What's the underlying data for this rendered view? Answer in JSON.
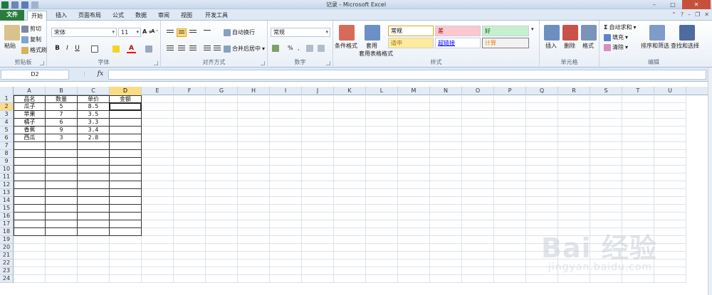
{
  "window": {
    "title": "记录 - Microsoft Excel"
  },
  "tabs": {
    "file": "文件",
    "items": [
      "开始",
      "插入",
      "页面布局",
      "公式",
      "数据",
      "审阅",
      "视图",
      "开发工具"
    ]
  },
  "ribbon": {
    "clipboard": {
      "label": "剪贴板",
      "paste": "粘贴",
      "cut": "剪切",
      "copy": "复制",
      "format_painter": "格式刷"
    },
    "font": {
      "label": "字体",
      "name": "宋体",
      "size": "11",
      "bold": "B",
      "italic": "I",
      "underline": "U"
    },
    "alignment": {
      "label": "对齐方式",
      "wrap": "自动换行",
      "merge": "合并后居中"
    },
    "number": {
      "label": "数字",
      "format": "常规",
      "percent": "%"
    },
    "styles": {
      "label": "样式",
      "cond_format": "条件格式",
      "table_format": "套用表格格式",
      "cells": [
        {
          "text": "常规",
          "bg": "#ffffff",
          "fg": "#000000"
        },
        {
          "text": "差",
          "bg": "#ffc7ce",
          "fg": "#9c0006"
        },
        {
          "text": "好",
          "bg": "#c6efce",
          "fg": "#006100"
        },
        {
          "text": "适中",
          "bg": "#ffeb9c",
          "fg": "#9c6500"
        },
        {
          "text": "超链接",
          "bg": "#ffffff",
          "fg": "#0000ff"
        },
        {
          "text": "计算",
          "bg": "#f2f2f2",
          "fg": "#fa7d00"
        }
      ]
    },
    "cells_group": {
      "label": "单元格",
      "insert": "插入",
      "delete": "删除",
      "format": "格式"
    },
    "editing": {
      "label": "编辑",
      "autosum": "自动求和",
      "fill": "填充",
      "clear": "清除",
      "sort": "排序和筛选",
      "find": "查找和选择"
    }
  },
  "formula_bar": {
    "name_box": "D2",
    "fx": "fx",
    "value": ""
  },
  "sheet": {
    "columns": [
      "A",
      "B",
      "C",
      "D",
      "E",
      "F",
      "G",
      "H",
      "I",
      "J",
      "K",
      "L",
      "M",
      "N",
      "O",
      "P",
      "Q",
      "R",
      "S",
      "T",
      "U"
    ],
    "selected_column": "D",
    "selected_row": 2,
    "rows": [
      "1",
      "2",
      "3",
      "4",
      "5",
      "6",
      "7",
      "8",
      "9",
      "10",
      "11",
      "12",
      "13",
      "14",
      "15",
      "16",
      "17",
      "18",
      "19",
      "20",
      "21",
      "22",
      "23",
      "24"
    ],
    "data": [
      [
        "品名",
        "数量",
        "单价",
        "金额"
      ],
      [
        "瓜子",
        "5",
        "8.5",
        ""
      ],
      [
        "苹果",
        "7",
        "3.5",
        ""
      ],
      [
        "橘子",
        "6",
        "3.3",
        ""
      ],
      [
        "香蕉",
        "9",
        "3.4",
        ""
      ],
      [
        "西瓜",
        "3",
        "2.8",
        ""
      ]
    ]
  },
  "watermark": {
    "logo": "Bai 经验",
    "url": "jingyan.baidu.com"
  }
}
